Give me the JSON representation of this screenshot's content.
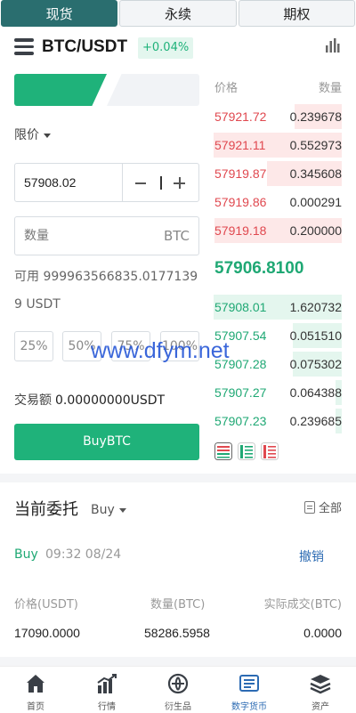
{
  "top_tabs": [
    {
      "label": "现货",
      "active": true
    },
    {
      "label": "永续",
      "active": false
    },
    {
      "label": "期权",
      "active": false
    }
  ],
  "pair": {
    "name": "BTC/USDT",
    "change": "+0.04%"
  },
  "trade_form": {
    "order_type": "限价",
    "price_value": "57908.02",
    "quantity_placeholder": "数量",
    "quantity_unit": "BTC",
    "available": "可用 999963566835.01771399 USDT",
    "percents": [
      "25%",
      "50%",
      "75%",
      "100%"
    ],
    "turnover_label": "交易额",
    "turnover_value": "0.00000000USDT",
    "buy_button": "BuyBTC"
  },
  "order_book": {
    "price_header": "价格",
    "qty_header": "数量",
    "asks": [
      {
        "price": "57921.72",
        "qty": "0.239678",
        "depth": 0.37
      },
      {
        "price": "57921.11",
        "qty": "0.552973",
        "depth": 1.0
      },
      {
        "price": "57919.87",
        "qty": "0.345608",
        "depth": 0.58
      },
      {
        "price": "57919.86",
        "qty": "0.000291",
        "depth": 0.0
      },
      {
        "price": "57919.18",
        "qty": "0.200000",
        "depth": 0.99
      }
    ],
    "last_price": "57906.8100",
    "bids": [
      {
        "price": "57908.01",
        "qty": "1.620732",
        "depth": 1.0
      },
      {
        "price": "57907.54",
        "qty": "0.051510",
        "depth": 0.38
      },
      {
        "price": "57907.28",
        "qty": "0.075302",
        "depth": 0.38
      },
      {
        "price": "57907.27",
        "qty": "0.064388",
        "depth": 0.05
      },
      {
        "price": "57907.23",
        "qty": "0.239685",
        "depth": 0.05
      }
    ]
  },
  "orders": {
    "title": "当前委托",
    "filter": "Buy",
    "all_label": "全部",
    "row": {
      "side": "Buy",
      "time": "09:32 08/24",
      "cancel": "撤销",
      "headers": [
        "价格(USDT)",
        "数量(BTC)",
        "实际成交(BTC)"
      ],
      "values": [
        "17090.0000",
        "58286.5958",
        "0.0000"
      ]
    }
  },
  "bottom_nav": [
    {
      "label": "首页",
      "icon": "home-icon"
    },
    {
      "label": "行情",
      "icon": "market-chart-icon"
    },
    {
      "label": "衍生品",
      "icon": "derivatives-icon"
    },
    {
      "label": "数字货币",
      "icon": "spot-trade-icon",
      "active": true
    },
    {
      "label": "资产",
      "icon": "assets-stack-icon"
    }
  ],
  "watermark": "www.dfym.net",
  "colors": {
    "accent_green": "#1fb27a",
    "sell_red": "#e0484f",
    "active_tab": "#2a6e6f",
    "link_blue": "#2c6bb3"
  }
}
